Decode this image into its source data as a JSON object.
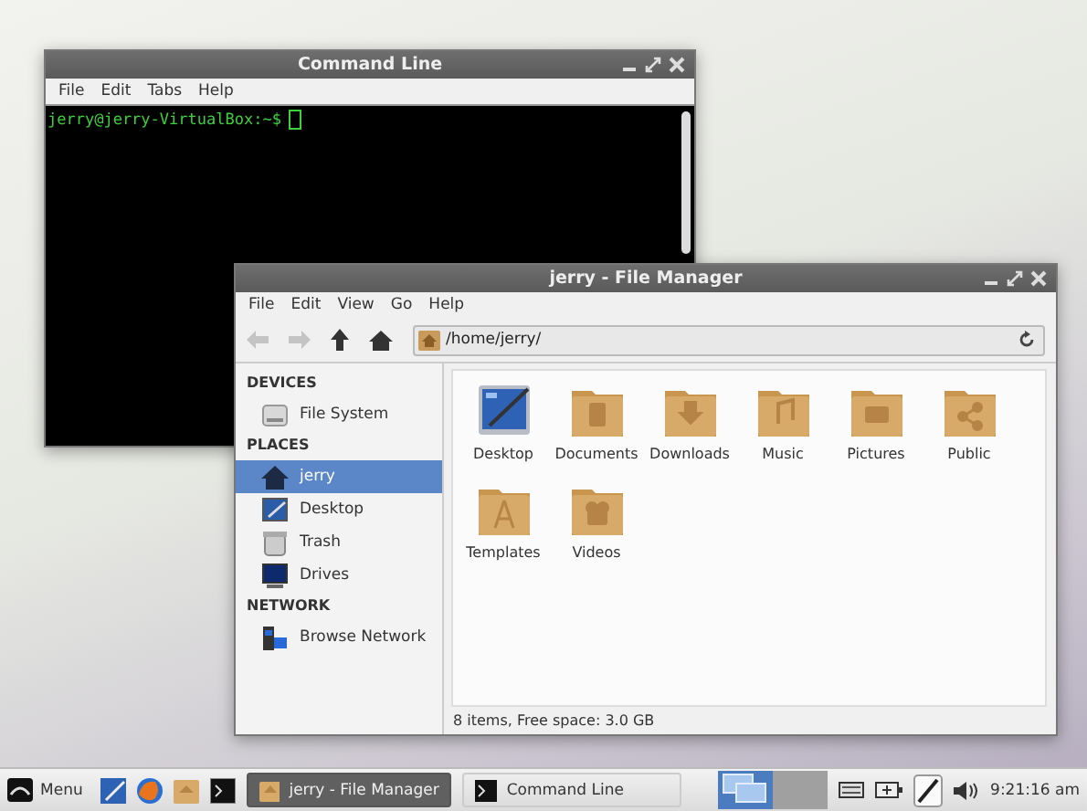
{
  "terminal": {
    "title": "Command Line",
    "menu": [
      "File",
      "Edit",
      "Tabs",
      "Help"
    ],
    "prompt": "jerry@jerry-VirtualBox:~$"
  },
  "file_manager": {
    "title": "jerry - File Manager",
    "menu": [
      "File",
      "Edit",
      "View",
      "Go",
      "Help"
    ],
    "path": "/home/jerry/",
    "sidebar": [
      {
        "heading": "DEVICES",
        "items": [
          {
            "label": "File System",
            "kind": "disk",
            "selected": false
          }
        ]
      },
      {
        "heading": "PLACES",
        "items": [
          {
            "label": "jerry",
            "kind": "home",
            "selected": true
          },
          {
            "label": "Desktop",
            "kind": "desktop",
            "selected": false
          },
          {
            "label": "Trash",
            "kind": "trash",
            "selected": false
          },
          {
            "label": "Drives",
            "kind": "monitor",
            "selected": false
          }
        ]
      },
      {
        "heading": "NETWORK",
        "items": [
          {
            "label": "Browse Network",
            "kind": "network",
            "selected": false
          }
        ]
      }
    ],
    "files": [
      {
        "name": "Desktop",
        "kind": "desktop"
      },
      {
        "name": "Documents",
        "kind": "document"
      },
      {
        "name": "Downloads",
        "kind": "download"
      },
      {
        "name": "Music",
        "kind": "music"
      },
      {
        "name": "Pictures",
        "kind": "camera"
      },
      {
        "name": "Public",
        "kind": "share"
      },
      {
        "name": "Templates",
        "kind": "compass"
      },
      {
        "name": "Videos",
        "kind": "video"
      }
    ],
    "status": "8 items, Free space: 3.0 GB"
  },
  "taskbar": {
    "menu_label": "Menu",
    "tasks": [
      {
        "label": "jerry - File Manager",
        "kind": "folder",
        "selected": true
      },
      {
        "label": "Command Line",
        "kind": "terminal",
        "selected": false
      }
    ],
    "workspaces": [
      {
        "selected": true
      },
      {
        "selected": false
      }
    ],
    "clock": "9:21:16 am"
  }
}
